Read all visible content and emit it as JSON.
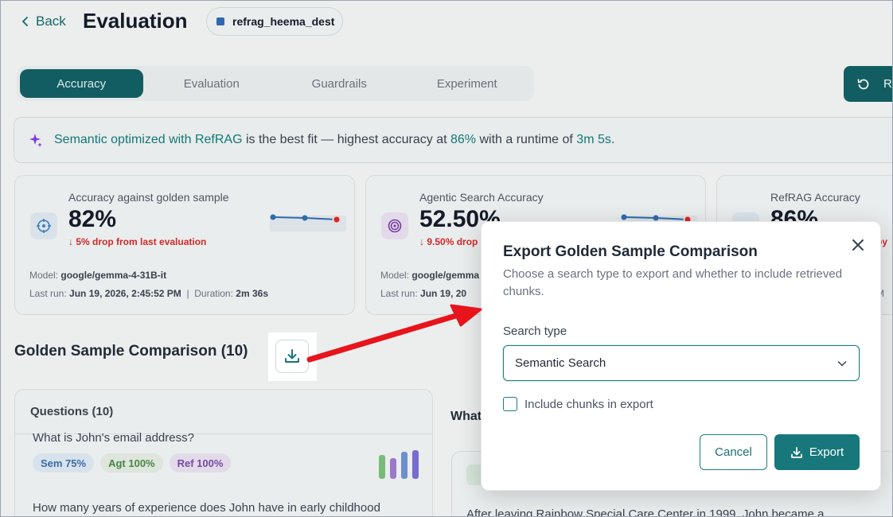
{
  "header": {
    "back_label": "Back",
    "title": "Evaluation",
    "database": "refrag_heema_dest"
  },
  "tabs": [
    {
      "label": "Accuracy",
      "active": true
    },
    {
      "label": "Evaluation",
      "active": false
    },
    {
      "label": "Guardrails",
      "active": false
    },
    {
      "label": "Experiment",
      "active": false
    }
  ],
  "toolbar": {
    "refresh_label": "R"
  },
  "banner": {
    "highlight1": "Semantic optimized with RefRAG",
    "text1": " is the best fit — highest accuracy at ",
    "highlight2": "86%",
    "text2": " with a runtime of ",
    "highlight3": "3m 5s",
    "text3": "."
  },
  "cards": [
    {
      "label": "Accuracy against golden sample",
      "value": "82%",
      "delta": "5% drop from last evaluation",
      "model_label": "Model:",
      "model": "google/gemma-4-31B-it",
      "last_run_label": "Last run:",
      "last_run": "Jun 19, 2026, 2:45:52 PM",
      "duration_label": "Duration:",
      "duration": "2m 36s",
      "icon": "target-icon"
    },
    {
      "label": "Agentic Search Accuracy",
      "value": "52.50%",
      "delta": "9.50% drop",
      "model_label": "Model:",
      "model": "google/gemma",
      "last_run_label": "Last run:",
      "last_run": "Jun 19, 20",
      "icon": "radar-icon"
    },
    {
      "label": "RefRAG Accuracy",
      "value": "86%",
      "delta": "by",
      "model_label": "",
      "model": "",
      "last_run_label": "",
      "last_run": "M",
      "icon": "refrag-icon"
    }
  ],
  "golden_sample": {
    "title": "Golden Sample Comparison (10)",
    "questions_header": "Questions (10)",
    "q1": "What is John's email address?",
    "chips": [
      "Sem 75%",
      "Agt 100%",
      "Ref 100%"
    ],
    "q2": "How many years of experience does John have in early childhood",
    "right_header": "What",
    "answer_text": "After leaving Rainbow Special Care Center in 1999, John became a"
  },
  "modal": {
    "title": "Export Golden Sample Comparison",
    "description": "Choose a search type to export and whether to include retrieved chunks.",
    "search_type_label": "Search type",
    "search_type_value": "Semantic Search",
    "include_chunks_label": "Include chunks in export",
    "include_chunks_checked": false,
    "cancel_label": "Cancel",
    "export_label": "Export"
  },
  "colors": {
    "accent": "#17777a",
    "delta_red": "#dc2626",
    "annotation_arrow": "#e8141c"
  }
}
